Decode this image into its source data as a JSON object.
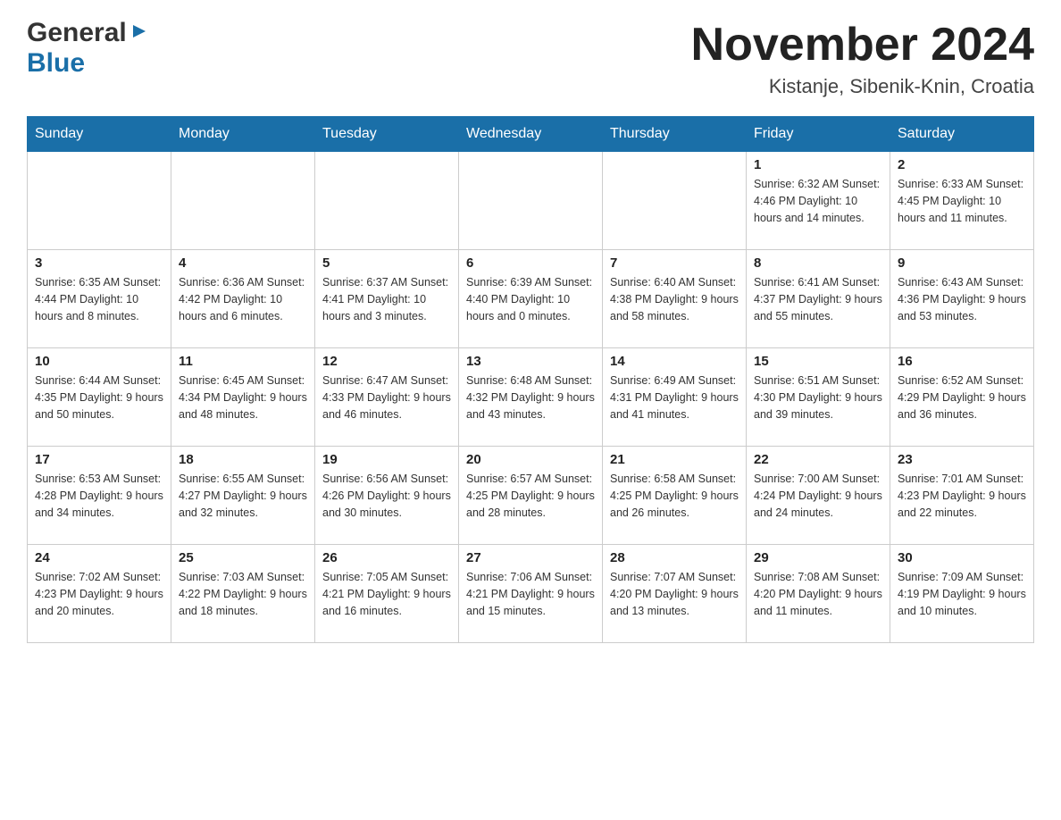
{
  "header": {
    "logo_general": "General",
    "logo_blue": "Blue",
    "month_title": "November 2024",
    "location": "Kistanje, Sibenik-Knin, Croatia"
  },
  "days_of_week": [
    "Sunday",
    "Monday",
    "Tuesday",
    "Wednesday",
    "Thursday",
    "Friday",
    "Saturday"
  ],
  "weeks": [
    {
      "days": [
        {
          "number": "",
          "info": ""
        },
        {
          "number": "",
          "info": ""
        },
        {
          "number": "",
          "info": ""
        },
        {
          "number": "",
          "info": ""
        },
        {
          "number": "",
          "info": ""
        },
        {
          "number": "1",
          "info": "Sunrise: 6:32 AM\nSunset: 4:46 PM\nDaylight: 10 hours\nand 14 minutes."
        },
        {
          "number": "2",
          "info": "Sunrise: 6:33 AM\nSunset: 4:45 PM\nDaylight: 10 hours\nand 11 minutes."
        }
      ]
    },
    {
      "days": [
        {
          "number": "3",
          "info": "Sunrise: 6:35 AM\nSunset: 4:44 PM\nDaylight: 10 hours\nand 8 minutes."
        },
        {
          "number": "4",
          "info": "Sunrise: 6:36 AM\nSunset: 4:42 PM\nDaylight: 10 hours\nand 6 minutes."
        },
        {
          "number": "5",
          "info": "Sunrise: 6:37 AM\nSunset: 4:41 PM\nDaylight: 10 hours\nand 3 minutes."
        },
        {
          "number": "6",
          "info": "Sunrise: 6:39 AM\nSunset: 4:40 PM\nDaylight: 10 hours\nand 0 minutes."
        },
        {
          "number": "7",
          "info": "Sunrise: 6:40 AM\nSunset: 4:38 PM\nDaylight: 9 hours\nand 58 minutes."
        },
        {
          "number": "8",
          "info": "Sunrise: 6:41 AM\nSunset: 4:37 PM\nDaylight: 9 hours\nand 55 minutes."
        },
        {
          "number": "9",
          "info": "Sunrise: 6:43 AM\nSunset: 4:36 PM\nDaylight: 9 hours\nand 53 minutes."
        }
      ]
    },
    {
      "days": [
        {
          "number": "10",
          "info": "Sunrise: 6:44 AM\nSunset: 4:35 PM\nDaylight: 9 hours\nand 50 minutes."
        },
        {
          "number": "11",
          "info": "Sunrise: 6:45 AM\nSunset: 4:34 PM\nDaylight: 9 hours\nand 48 minutes."
        },
        {
          "number": "12",
          "info": "Sunrise: 6:47 AM\nSunset: 4:33 PM\nDaylight: 9 hours\nand 46 minutes."
        },
        {
          "number": "13",
          "info": "Sunrise: 6:48 AM\nSunset: 4:32 PM\nDaylight: 9 hours\nand 43 minutes."
        },
        {
          "number": "14",
          "info": "Sunrise: 6:49 AM\nSunset: 4:31 PM\nDaylight: 9 hours\nand 41 minutes."
        },
        {
          "number": "15",
          "info": "Sunrise: 6:51 AM\nSunset: 4:30 PM\nDaylight: 9 hours\nand 39 minutes."
        },
        {
          "number": "16",
          "info": "Sunrise: 6:52 AM\nSunset: 4:29 PM\nDaylight: 9 hours\nand 36 minutes."
        }
      ]
    },
    {
      "days": [
        {
          "number": "17",
          "info": "Sunrise: 6:53 AM\nSunset: 4:28 PM\nDaylight: 9 hours\nand 34 minutes."
        },
        {
          "number": "18",
          "info": "Sunrise: 6:55 AM\nSunset: 4:27 PM\nDaylight: 9 hours\nand 32 minutes."
        },
        {
          "number": "19",
          "info": "Sunrise: 6:56 AM\nSunset: 4:26 PM\nDaylight: 9 hours\nand 30 minutes."
        },
        {
          "number": "20",
          "info": "Sunrise: 6:57 AM\nSunset: 4:25 PM\nDaylight: 9 hours\nand 28 minutes."
        },
        {
          "number": "21",
          "info": "Sunrise: 6:58 AM\nSunset: 4:25 PM\nDaylight: 9 hours\nand 26 minutes."
        },
        {
          "number": "22",
          "info": "Sunrise: 7:00 AM\nSunset: 4:24 PM\nDaylight: 9 hours\nand 24 minutes."
        },
        {
          "number": "23",
          "info": "Sunrise: 7:01 AM\nSunset: 4:23 PM\nDaylight: 9 hours\nand 22 minutes."
        }
      ]
    },
    {
      "days": [
        {
          "number": "24",
          "info": "Sunrise: 7:02 AM\nSunset: 4:23 PM\nDaylight: 9 hours\nand 20 minutes."
        },
        {
          "number": "25",
          "info": "Sunrise: 7:03 AM\nSunset: 4:22 PM\nDaylight: 9 hours\nand 18 minutes."
        },
        {
          "number": "26",
          "info": "Sunrise: 7:05 AM\nSunset: 4:21 PM\nDaylight: 9 hours\nand 16 minutes."
        },
        {
          "number": "27",
          "info": "Sunrise: 7:06 AM\nSunset: 4:21 PM\nDaylight: 9 hours\nand 15 minutes."
        },
        {
          "number": "28",
          "info": "Sunrise: 7:07 AM\nSunset: 4:20 PM\nDaylight: 9 hours\nand 13 minutes."
        },
        {
          "number": "29",
          "info": "Sunrise: 7:08 AM\nSunset: 4:20 PM\nDaylight: 9 hours\nand 11 minutes."
        },
        {
          "number": "30",
          "info": "Sunrise: 7:09 AM\nSunset: 4:19 PM\nDaylight: 9 hours\nand 10 minutes."
        }
      ]
    }
  ]
}
